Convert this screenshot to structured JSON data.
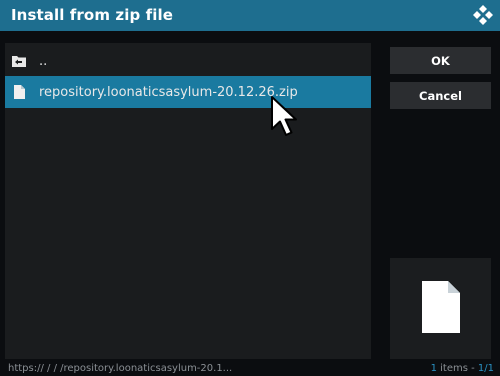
{
  "dialog": {
    "title": "Install from zip file"
  },
  "file_list": {
    "items": [
      {
        "label": "..",
        "icon": "folder-back-icon",
        "selected": false
      },
      {
        "label": "repository.loonaticsasylum-20.12.26.zip",
        "icon": "file-icon",
        "selected": true
      }
    ]
  },
  "buttons": {
    "ok_label": "OK",
    "cancel_label": "Cancel"
  },
  "footer": {
    "path": "https://  /  /  /repository.loonaticsasylum-20.1...",
    "count_number": "1",
    "count_label": " items - ",
    "page": "1/1"
  },
  "colors": {
    "accent": "#1e6e8f",
    "selected_row": "#1a7aa0",
    "panel": "#1a1c1e",
    "button": "#2b2d30"
  }
}
